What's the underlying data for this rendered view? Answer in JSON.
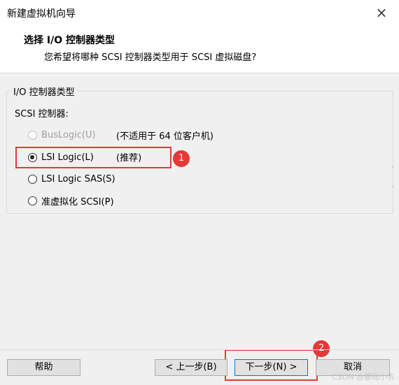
{
  "window": {
    "title": "新建虚拟机向导",
    "close_icon": "×"
  },
  "header": {
    "title": "选择 I/O 控制器类型",
    "subtitle": "您希望将哪种 SCSI 控制器类型用于 SCSI 虚拟磁盘?"
  },
  "group": {
    "legend": "I/O 控制器类型",
    "scsi_label": "SCSI 控制器:",
    "options": [
      {
        "label": "BusLogic(U)",
        "note": "(不适用于 64 位客户机)",
        "checked": false,
        "disabled": true
      },
      {
        "label": "LSI Logic(L)",
        "note": "(推荐)",
        "checked": true,
        "disabled": false
      },
      {
        "label": "LSI Logic SAS(S)",
        "checked": false,
        "disabled": false
      },
      {
        "label": "准虚拟化 SCSI(P)",
        "checked": false,
        "disabled": false
      }
    ]
  },
  "annotations": {
    "badge1": "1",
    "badge2": "2",
    "color": "#e53935"
  },
  "buttons": {
    "help": "帮助",
    "back": "< 上一步(B)",
    "next": "下一步(N) >",
    "cancel": "取消"
  },
  "watermark": "CSDN @基础小农"
}
